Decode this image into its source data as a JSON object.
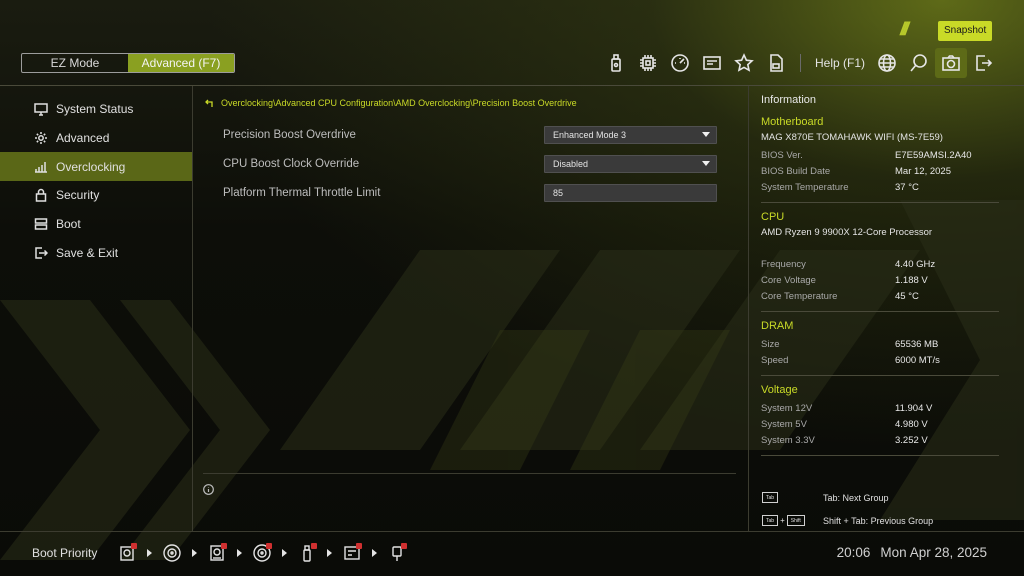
{
  "header": {
    "modes": [
      {
        "label": "EZ Mode",
        "active": false
      },
      {
        "label": "Advanced (F7)",
        "active": true
      }
    ],
    "icons": [
      "usb-flash-icon",
      "cpu-icon",
      "gauge-icon",
      "hardware-monitor-icon",
      "favorites-star-icon",
      "file-icon"
    ],
    "help_label": "Help (F1)",
    "right_icons": [
      "globe-icon",
      "search-icon",
      "camera-icon",
      "exit-icon"
    ],
    "tooltip": "Snapshot",
    "accent_color": "#c9da27"
  },
  "sidebar": {
    "items": [
      {
        "label": "System Status",
        "icon": "monitor-icon",
        "active": false
      },
      {
        "label": "Advanced",
        "icon": "gear-icon",
        "active": false
      },
      {
        "label": "Overclocking",
        "icon": "chart-bars-icon",
        "active": true
      },
      {
        "label": "Security",
        "icon": "lock-icon",
        "active": false
      },
      {
        "label": "Boot",
        "icon": "boot-drive-icon",
        "active": false
      },
      {
        "label": "Save & Exit",
        "icon": "exit-door-icon",
        "active": false
      }
    ]
  },
  "main": {
    "breadcrumb": "Overclocking\\Advanced CPU Configuration\\AMD Overclocking\\Precision Boost Overdrive",
    "settings": [
      {
        "label": "Precision Boost Overdrive",
        "value": "Enhanced Mode 3",
        "type": "dropdown"
      },
      {
        "label": "CPU Boost Clock Override",
        "value": "Disabled",
        "type": "dropdown"
      },
      {
        "label": "Platform Thermal Throttle Limit",
        "value": "85",
        "type": "input"
      }
    ]
  },
  "info": {
    "title": "Information",
    "motherboard": {
      "heading": "Motherboard",
      "model": "MAG X870E TOMAHAWK WIFI (MS-7E59)",
      "rows": [
        {
          "k": "BIOS Ver.",
          "v": "E7E59AMSI.2A40"
        },
        {
          "k": "BIOS Build Date",
          "v": "Mar 12, 2025"
        },
        {
          "k": "System Temperature",
          "v": "37 °C"
        }
      ]
    },
    "cpu": {
      "heading": "CPU",
      "model": "AMD Ryzen 9 9900X 12-Core Processor",
      "rows": [
        {
          "k": "Frequency",
          "v": "4.40 GHz"
        },
        {
          "k": "Core Voltage",
          "v": "1.188 V"
        },
        {
          "k": "Core Temperature",
          "v": "45 °C"
        }
      ]
    },
    "dram": {
      "heading": "DRAM",
      "rows": [
        {
          "k": "Size",
          "v": "65536 MB"
        },
        {
          "k": "Speed",
          "v": "6000 MT/s"
        }
      ]
    },
    "voltage": {
      "heading": "Voltage",
      "rows": [
        {
          "k": "System 12V",
          "v": "11.904 V"
        },
        {
          "k": "System 5V",
          "v": "4.980 V"
        },
        {
          "k": "System 3.3V",
          "v": "3.252 V"
        }
      ]
    },
    "hints": {
      "tab_key": "Tab",
      "shift_key": "Shift",
      "plus": "+",
      "next": "Tab: Next Group",
      "prev": "Shift + Tab: Previous Group"
    }
  },
  "footer": {
    "boot_label": "Boot Priority",
    "boot_devices": [
      "network-boot-icon",
      "optical-disc-icon",
      "hard-drive-icon",
      "optical-disc-icon",
      "usb-icon",
      "usb-drive-icon",
      "usb-key-icon"
    ],
    "time": "20:06",
    "date": "Mon Apr 28, 2025"
  }
}
